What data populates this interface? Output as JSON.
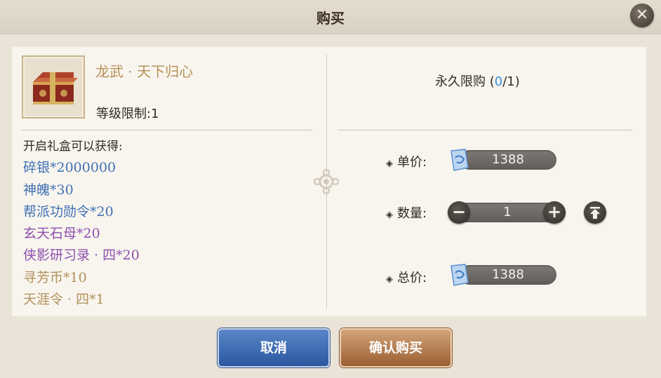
{
  "dialog": {
    "title": "购买",
    "close_icon": "close-x-icon"
  },
  "item": {
    "icon": "gift-chest-icon",
    "name": "龙武 · 天下归心",
    "level_label": "等级限制:1"
  },
  "rewards": {
    "heading": "开启礼盒可以获得:",
    "list": [
      {
        "text": "碎银*2000000",
        "color": "#3f6fb5"
      },
      {
        "text": "神魄*30",
        "color": "#3f6fb5"
      },
      {
        "text": "帮派功勋令*20",
        "color": "#3f6fb5"
      },
      {
        "text": "玄天石母*20",
        "color": "#8d4fb0"
      },
      {
        "text": "侠影研习录 · 四*20",
        "color": "#8d4fb0"
      },
      {
        "text": "寻芳币*10",
        "color": "#b0915c"
      },
      {
        "text": "天涯令 · 四*1",
        "color": "#b0915c"
      }
    ]
  },
  "purchase": {
    "limit_prefix": "永久限购 (",
    "limit_current": "0",
    "limit_suffix": "/1)",
    "unit_price_label": "单价:",
    "unit_price": "1388",
    "quantity_label": "数量:",
    "quantity": "1",
    "total_label": "总价:",
    "total_price": "1388",
    "currency_icon": "coupon-icon",
    "minus": "−",
    "plus": "+",
    "max_icon": "max-arrow-icon"
  },
  "buttons": {
    "cancel_label": "取消",
    "confirm_label": "确认购买"
  },
  "colors": {
    "cancel_bg": "#2c57a0",
    "confirm_bg": "#9c5f33",
    "limit_current": "#3b8ed8"
  }
}
